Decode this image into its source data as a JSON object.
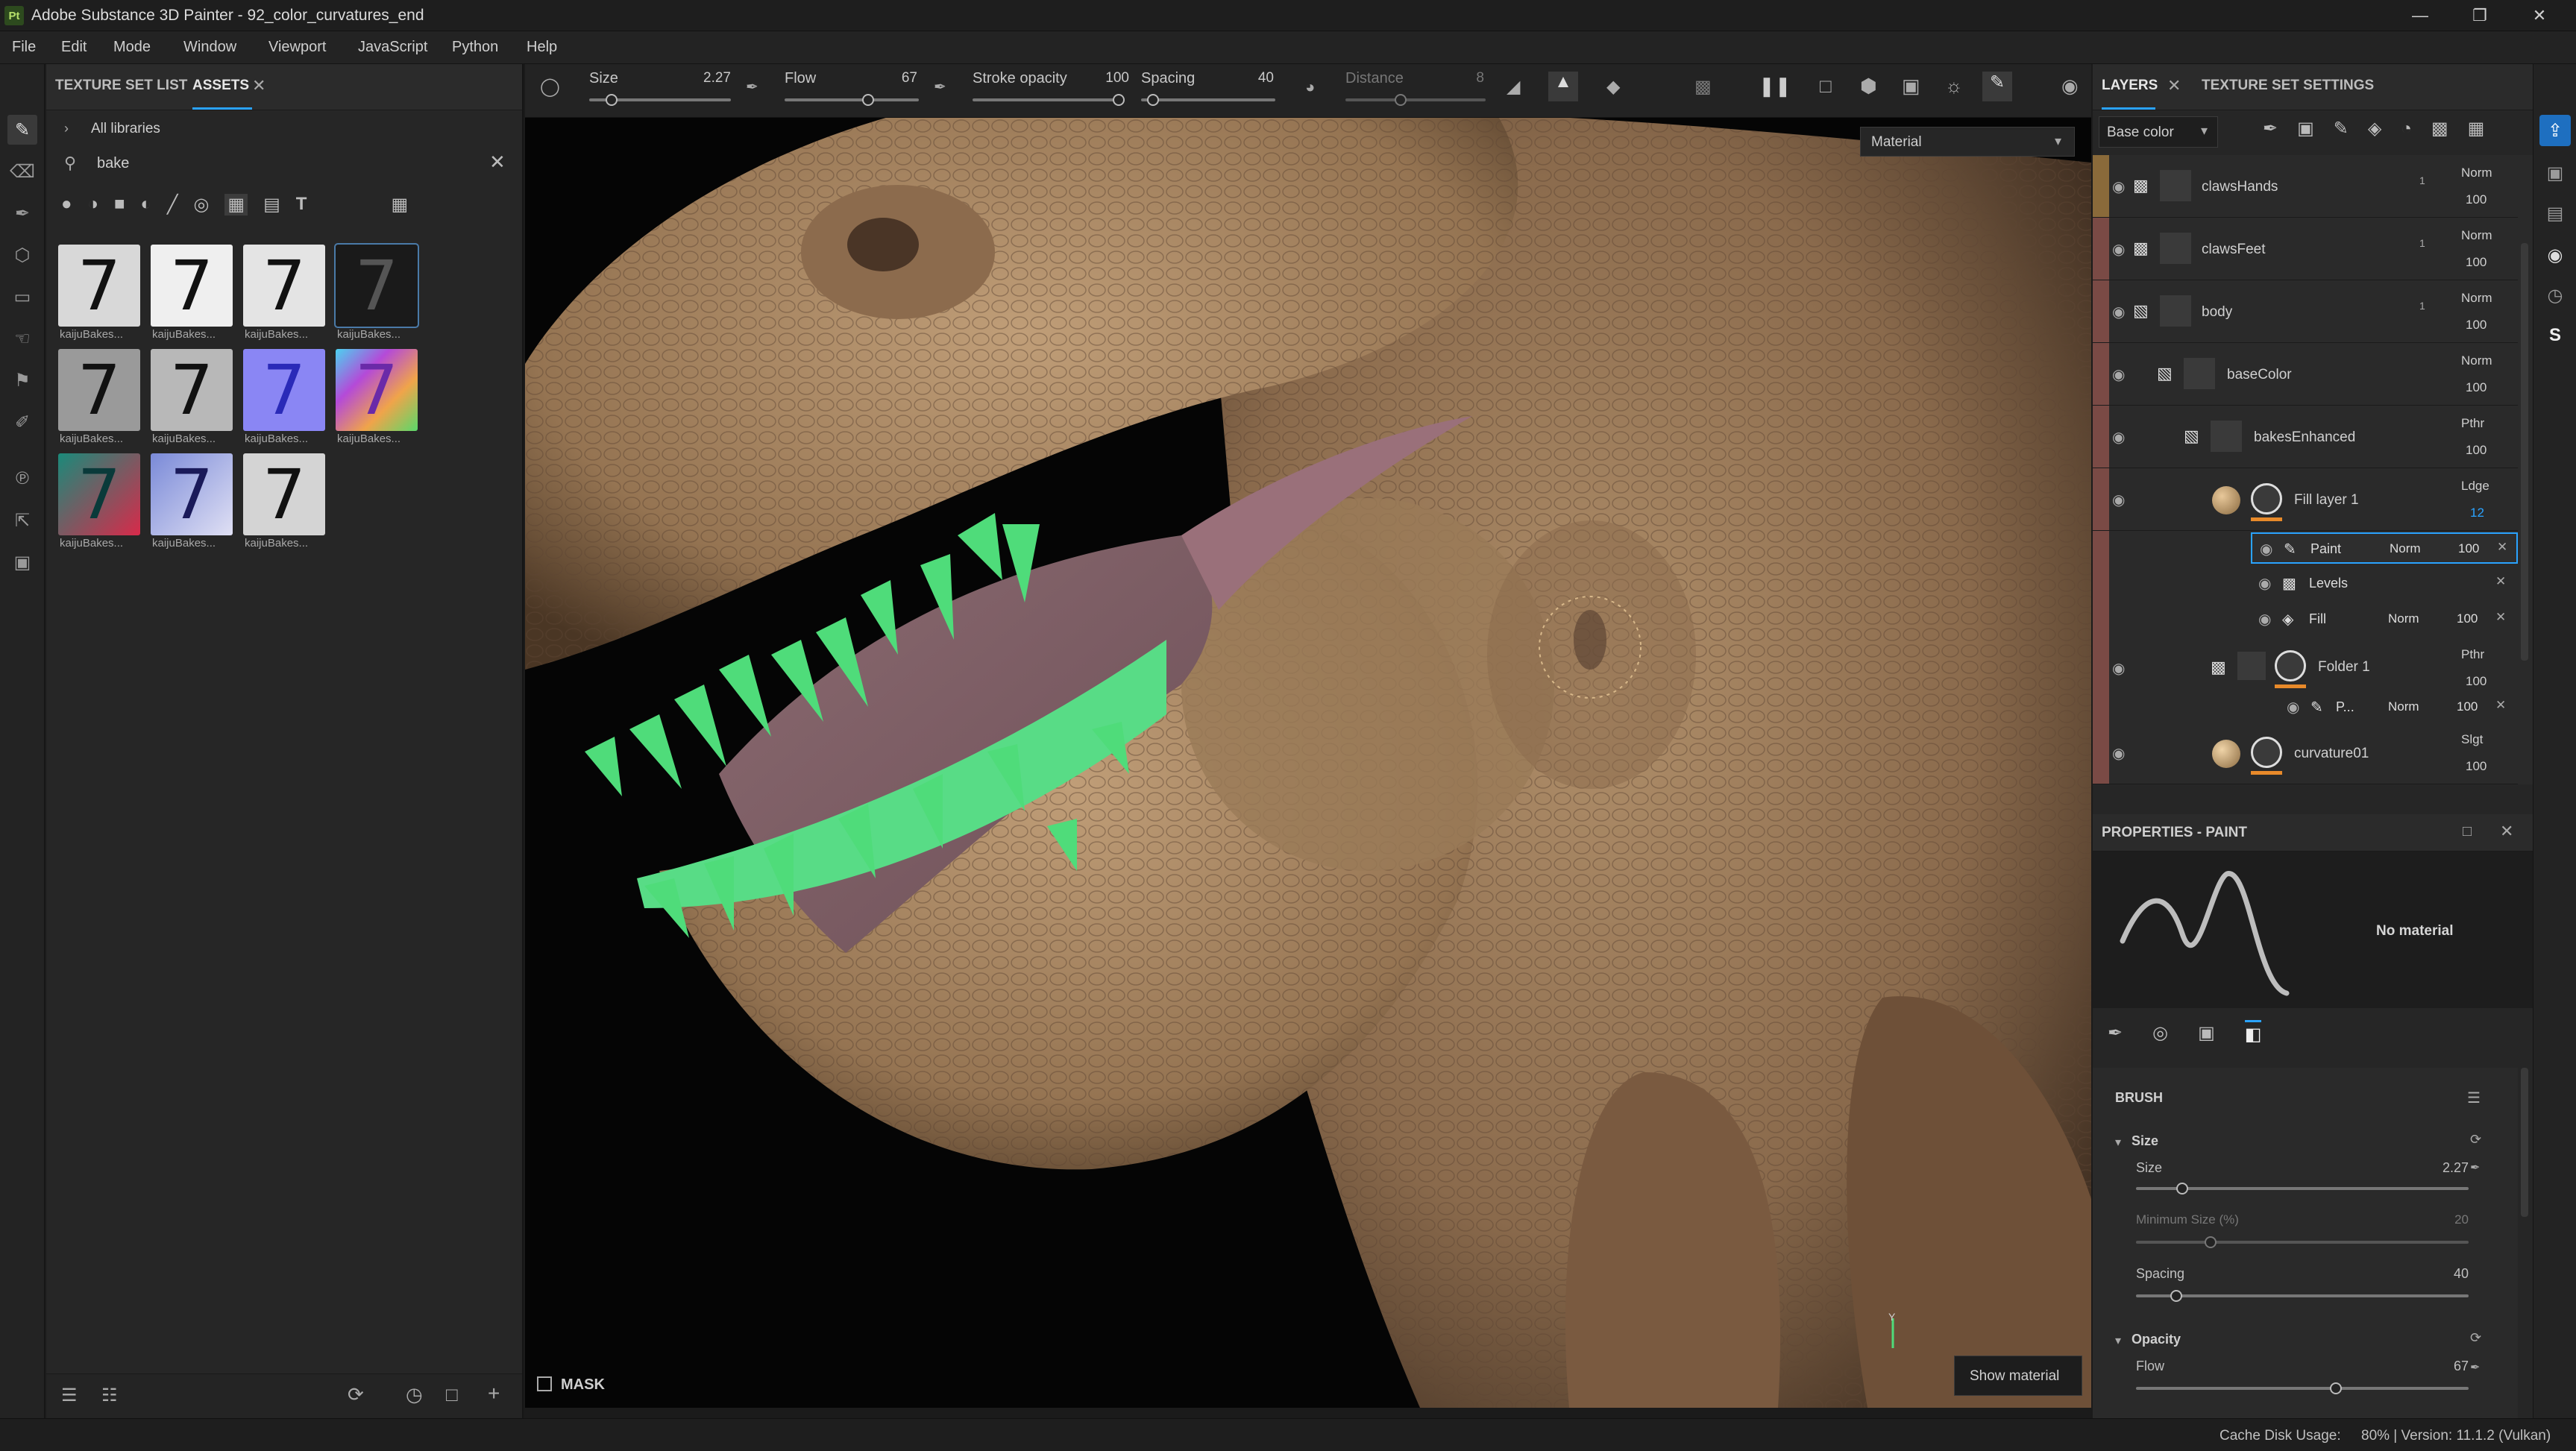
{
  "window": {
    "title": "Adobe Substance 3D Painter - 92_color_curvatures_end",
    "logo": "Pt"
  },
  "menu": [
    "File",
    "Edit",
    "Mode",
    "Window",
    "Viewport",
    "JavaScript",
    "Python",
    "Help"
  ],
  "assets_panel": {
    "tabs": [
      "TEXTURE SET LIST",
      "ASSETS"
    ],
    "libraries": "All libraries",
    "search_value": "bake",
    "thumb_glyph": "7",
    "thumbnails": [
      {
        "label": "kaijuBakes..."
      },
      {
        "label": "kaijuBakes..."
      },
      {
        "label": "kaijuBakes..."
      },
      {
        "label": "kaijuBakes..."
      },
      {
        "label": "kaijuBakes..."
      },
      {
        "label": "kaijuBakes..."
      },
      {
        "label": "kaijuBakes..."
      },
      {
        "label": "kaijuBakes..."
      },
      {
        "label": "kaijuBakes..."
      },
      {
        "label": "kaijuBakes..."
      },
      {
        "label": "kaijuBakes..."
      }
    ]
  },
  "toolbar": {
    "size_label": "Size",
    "size_value": "2.27",
    "flow_label": "Flow",
    "flow_value": "67",
    "stroke_label": "Stroke opacity",
    "stroke_value": "100",
    "spacing_label": "Spacing",
    "spacing_value": "40",
    "distance_label": "Distance",
    "distance_value": "8"
  },
  "viewport": {
    "material_select": "Material",
    "mask_label": "MASK",
    "show_material": "Show material",
    "axis_label": "Y"
  },
  "layers_panel": {
    "tabs": [
      "LAYERS",
      "TEXTURE SET SETTINGS"
    ],
    "channel": "Base color",
    "layers": [
      {
        "name": "clawsHands",
        "blend": "Norm",
        "opacity": "100",
        "count": "1"
      },
      {
        "name": "clawsFeet",
        "blend": "Norm",
        "opacity": "100",
        "count": "1"
      },
      {
        "name": "body",
        "blend": "Norm",
        "opacity": "100",
        "count": "1"
      },
      {
        "name": "baseColor",
        "blend": "Norm",
        "opacity": "100"
      },
      {
        "name": "bakesEnhanced",
        "blend": "Pthr",
        "opacity": "100"
      },
      {
        "name": "Fill layer 1",
        "blend": "Ldge",
        "opacity": "12"
      },
      {
        "name": "Folder 1",
        "blend": "Pthr",
        "opacity": "100"
      },
      {
        "name": "curvature01",
        "blend": "Slgt",
        "opacity": "100"
      }
    ],
    "effects": [
      {
        "name": "Paint",
        "blend": "Norm",
        "opacity": "100"
      },
      {
        "name": "Levels"
      },
      {
        "name": "Fill",
        "blend": "Norm",
        "opacity": "100"
      }
    ],
    "folder_effect": {
      "name": "P...",
      "blend": "Norm",
      "opacity": "100"
    }
  },
  "properties": {
    "title": "PROPERTIES - PAINT",
    "no_material": "No material",
    "brush_header": "BRUSH",
    "size_section": "Size",
    "size_label": "Size",
    "size_value": "2.27",
    "min_size_label": "Minimum Size (%)",
    "min_size_value": "20",
    "spacing_label": "Spacing",
    "spacing_value": "40",
    "opacity_section": "Opacity",
    "flow_label": "Flow",
    "flow_value": "67"
  },
  "status": {
    "cache": "Cache Disk Usage:",
    "cache_value": "80% | Version: 11.1.2 (Vulkan)"
  },
  "colors": {
    "accent": "#2aa3ff",
    "layer_tab": "#7a4a45",
    "green_teeth": "#4fdc7a",
    "skin": "#9c7a58"
  }
}
